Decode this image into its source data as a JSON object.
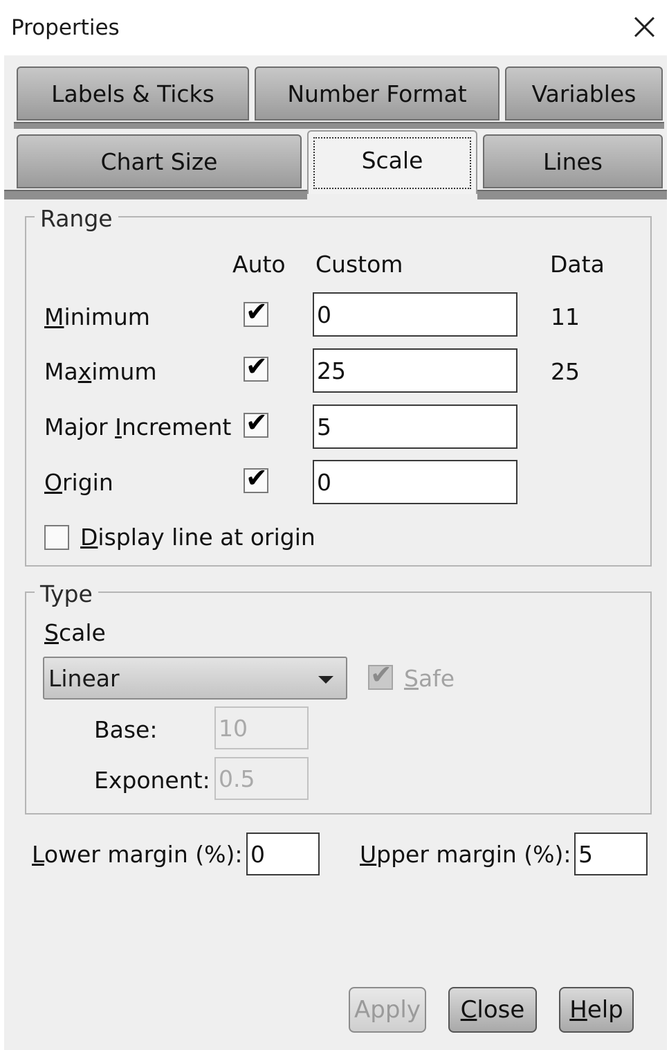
{
  "window": {
    "title": "Properties"
  },
  "tabs": {
    "row1": [
      "Labels & Ticks",
      "Number Format",
      "Variables"
    ],
    "row2": [
      "Chart Size",
      "Scale",
      "Lines"
    ],
    "active": "Scale"
  },
  "range": {
    "title": "Range",
    "headers": {
      "auto": "Auto",
      "custom": "Custom",
      "data": "Data"
    },
    "rows": [
      {
        "label_u": "M",
        "label_rest": "inimum",
        "auto": true,
        "custom": "0",
        "data": "11"
      },
      {
        "label_pre": "Ma",
        "label_u": "x",
        "label_rest": "imum",
        "auto": true,
        "custom": "25",
        "data": "25"
      },
      {
        "label_pre": "Major ",
        "label_u": "I",
        "label_rest": "ncrement",
        "auto": true,
        "custom": "5",
        "data": ""
      },
      {
        "label_u": "O",
        "label_rest": "rigin",
        "auto": true,
        "custom": "0",
        "data": ""
      }
    ],
    "display_line": {
      "label_u": "D",
      "label_rest": "isplay line at origin",
      "checked": false
    }
  },
  "type": {
    "title": "Type",
    "scale_label_u": "S",
    "scale_label_rest": "cale",
    "scale_value": "Linear",
    "safe": {
      "label_u": "S",
      "label_rest": "afe",
      "checked": true,
      "enabled": false
    },
    "base_label": "Base:",
    "base_value": "10",
    "exponent_label": "Exponent:",
    "exponent_value": "0.5"
  },
  "margins": {
    "lower_label_u": "L",
    "lower_label_rest": "ower margin (%):",
    "lower_value": "0",
    "upper_label_u": "U",
    "upper_label_rest": "pper margin (%):",
    "upper_value": "5"
  },
  "buttons": {
    "apply": "Apply",
    "close_u": "C",
    "close_rest": "lose",
    "help_u": "H",
    "help_rest": "elp"
  }
}
